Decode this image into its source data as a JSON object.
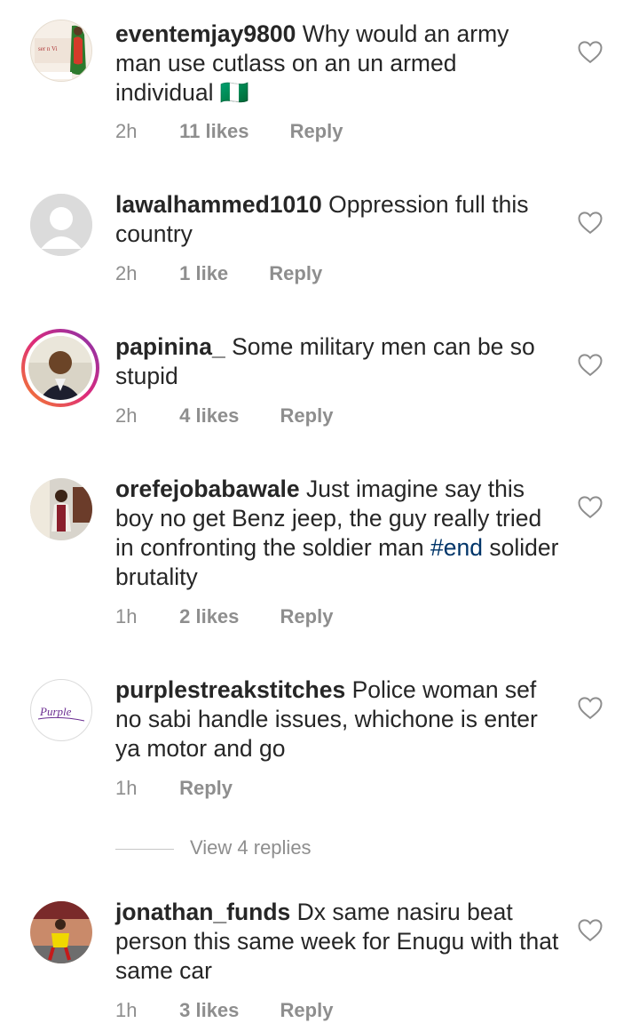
{
  "comments": [
    {
      "username": "eventemjay9800",
      "text": "Why would an army man use cutlass on an un  armed individual",
      "flag_emoji": "🇳🇬",
      "time": "2h",
      "likes": "11 likes",
      "reply": "Reply"
    },
    {
      "username": "lawalhammed1010",
      "text": "Oppression full this country",
      "time": "2h",
      "likes": "1 like",
      "reply": "Reply"
    },
    {
      "username": "papinina_",
      "text": "Some military men can be so stupid",
      "time": "2h",
      "likes": "4 likes",
      "reply": "Reply"
    },
    {
      "username": "orefejobabawale",
      "text": "Just imagine say this boy no get Benz jeep, the guy really tried in confronting the soldier man",
      "hashtag": "#end",
      "text_after_hashtag": "solider brutality",
      "time": "1h",
      "likes": "2 likes",
      "reply": "Reply"
    },
    {
      "username": "purplestreakstitches",
      "text": "Police woman sef no sabi handle issues, whichone is enter ya motor and go",
      "time": "1h",
      "reply": "Reply",
      "view_replies": "View 4 replies",
      "avatar_logo_text": "Purple"
    },
    {
      "username": "jonathan_funds",
      "text": "Dx same nasiru beat person this same week for Enugu with that same car",
      "time": "1h",
      "likes": "3 likes",
      "reply": "Reply"
    }
  ],
  "colors": {
    "username": "#262626",
    "meta": "#8e8e8e",
    "hashtag": "#003569",
    "story_ring_start": "#f58529",
    "story_ring_end": "#dd2a7b"
  },
  "icons": [
    "heart-icon",
    "default-avatar-icon"
  ]
}
